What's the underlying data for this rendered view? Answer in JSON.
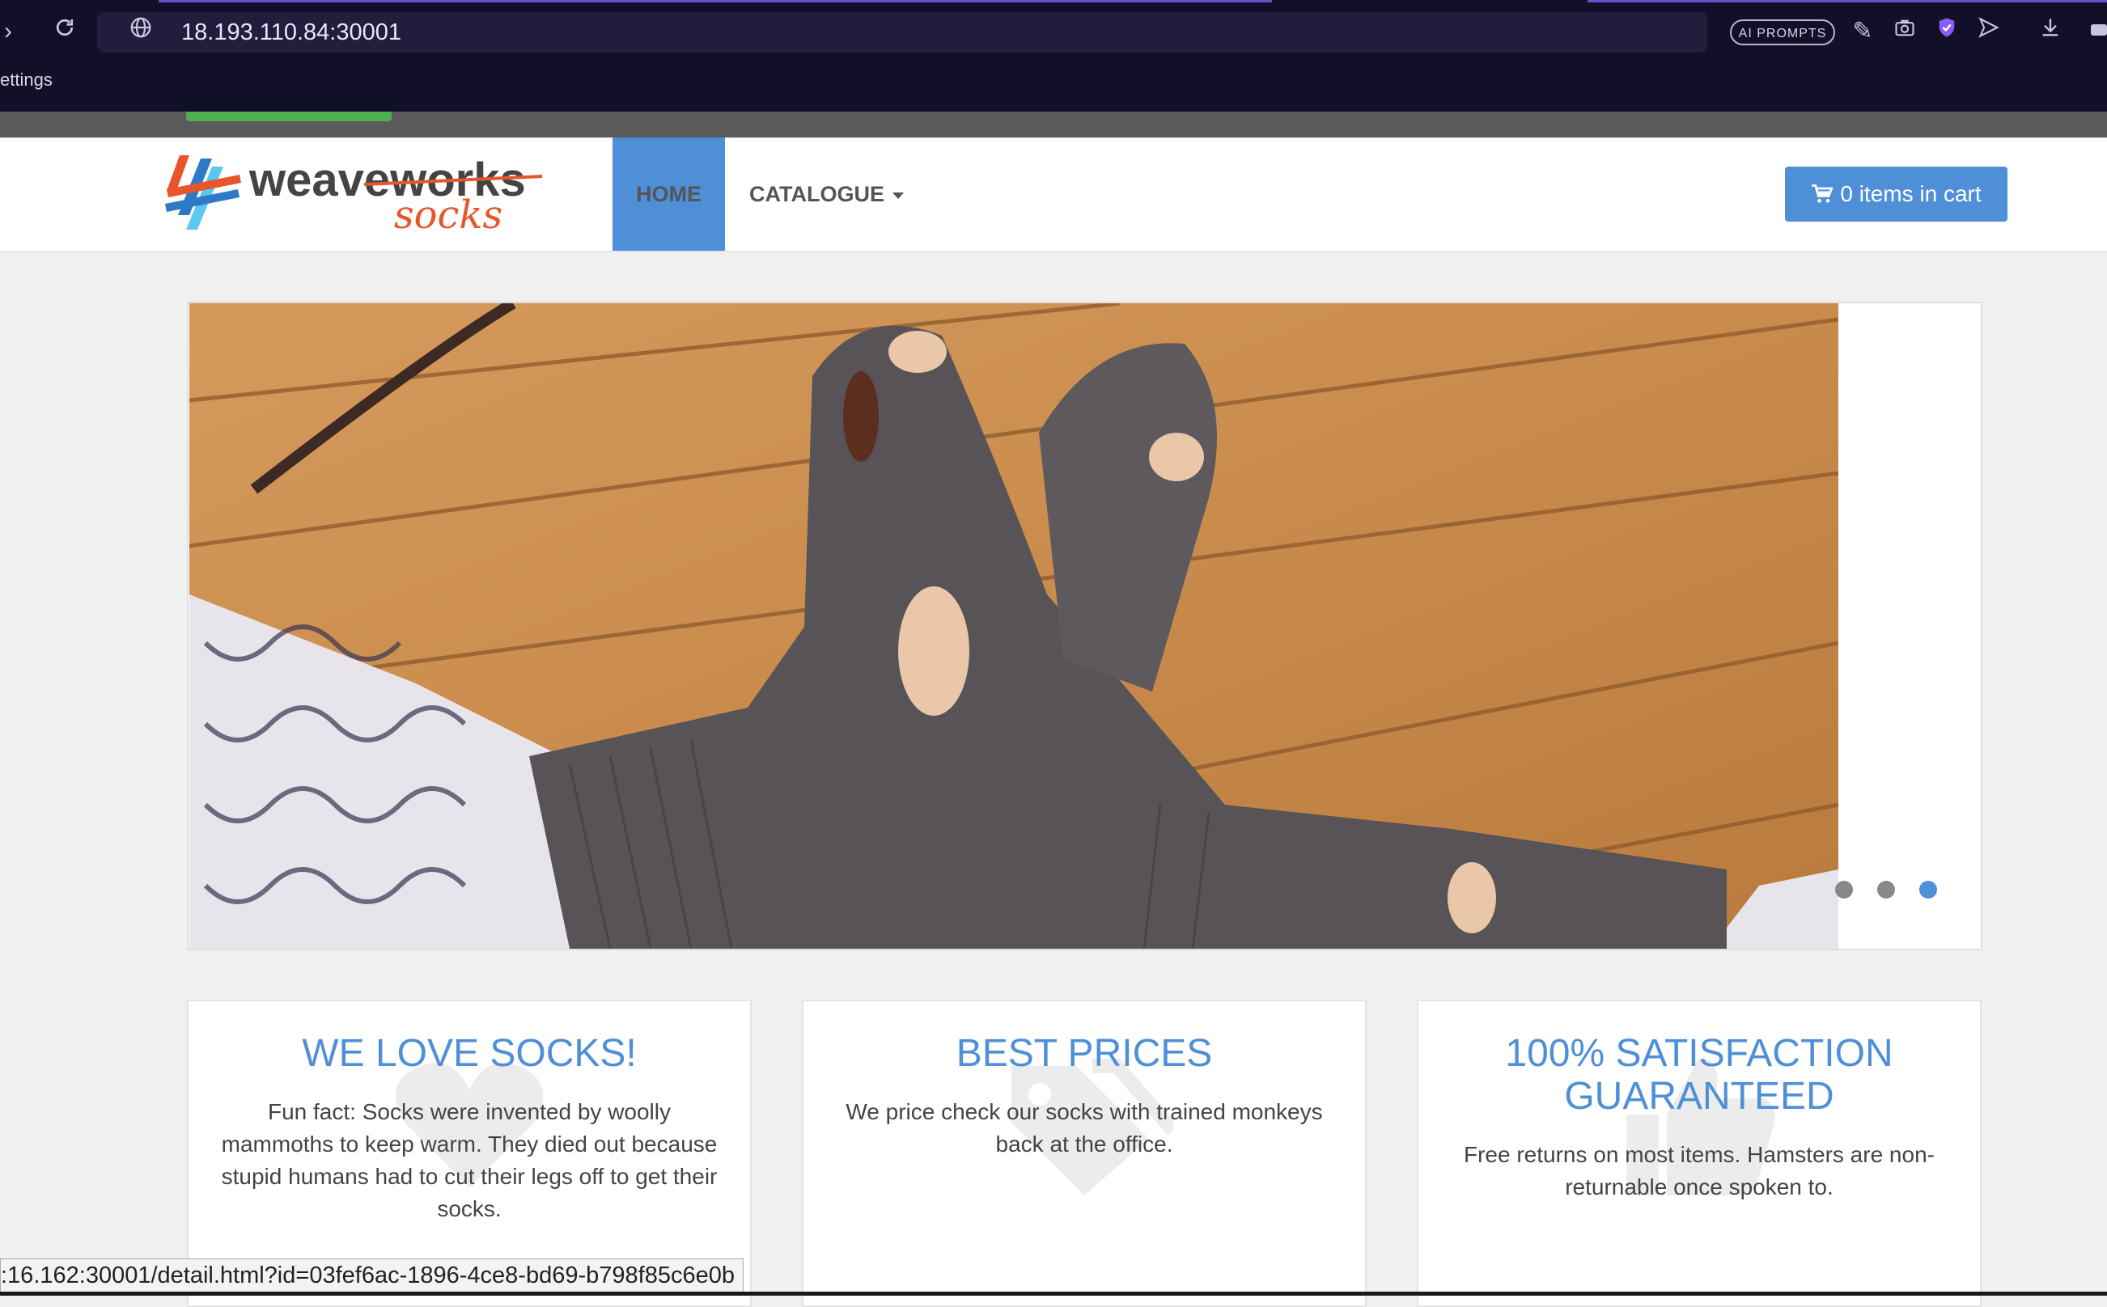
{
  "browser": {
    "url": "18.193.110.84:30001",
    "ai_prompts_label": "AI PROMPTS",
    "bookmark_label": "ettings",
    "status_url": ":16.162:30001/detail.html?id=03fef6ac-1896-4ce8-bd69-b798f85c6e0b"
  },
  "brand": {
    "word1": "weaveworks",
    "word2": "socks"
  },
  "nav": {
    "home": "HOME",
    "catalogue": "CATALOGUE",
    "cart": "0 items in cart"
  },
  "carousel": {
    "active_slide": 3,
    "slide_count": 3
  },
  "features": [
    {
      "title": "WE LOVE SOCKS!",
      "text": "Fun fact: Socks were invented by woolly mammoths to keep warm. They died out because stupid humans had to cut their legs off to get their socks.",
      "icon": "heart-icon"
    },
    {
      "title": "BEST PRICES",
      "text": "We price check our socks with trained monkeys back at the office.",
      "icon": "tags-icon"
    },
    {
      "title": "100% SATISFACTION GUARANTEED",
      "text": "Free returns on most items. Hamsters are non-returnable once spoken to.",
      "icon": "thumbs-up-icon"
    }
  ],
  "colors": {
    "accent": "#4f8fd8",
    "logo_orange": "#e8552b",
    "chrome_bg": "#120f28"
  }
}
